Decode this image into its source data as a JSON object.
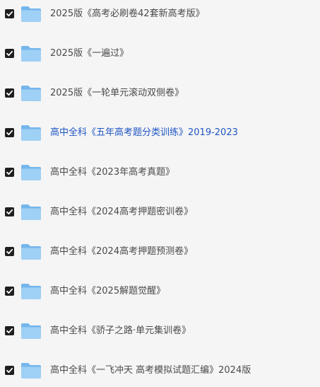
{
  "items": [
    {
      "name": "2025版《高考必刷卷42套新高考版》",
      "checked": true,
      "highlighted": false
    },
    {
      "name": "2025版《一遍过》",
      "checked": true,
      "highlighted": false
    },
    {
      "name": "2025版《一轮单元滚动双侧卷》",
      "checked": true,
      "highlighted": false
    },
    {
      "name": "高中全科《五年高考题分类训练》2019-2023",
      "checked": true,
      "highlighted": true
    },
    {
      "name": "高中全科《2023年高考真题》",
      "checked": true,
      "highlighted": false
    },
    {
      "name": "高中全科《2024高考押题密训卷》",
      "checked": true,
      "highlighted": false
    },
    {
      "name": "高中全科《2024高考押题预测卷》",
      "checked": true,
      "highlighted": false
    },
    {
      "name": "高中全科《2025解题觉醒》",
      "checked": true,
      "highlighted": false
    },
    {
      "name": "高中全科《骄子之路·单元集训卷》",
      "checked": true,
      "highlighted": false
    },
    {
      "name": "高中全科《一飞冲天 高考模拟试题汇编》2024版",
      "checked": true,
      "highlighted": false
    }
  ],
  "colors": {
    "background": "#f5f5f5",
    "text": "#4a4a4a",
    "highlight_text": "#1f56c4",
    "folder_light": "#9fd0f5",
    "folder_dark": "#74b6ec",
    "checkbox": "#1f1f1f"
  },
  "icons": {
    "checkbox": "checkbox-checked-icon",
    "folder": "folder-icon"
  }
}
